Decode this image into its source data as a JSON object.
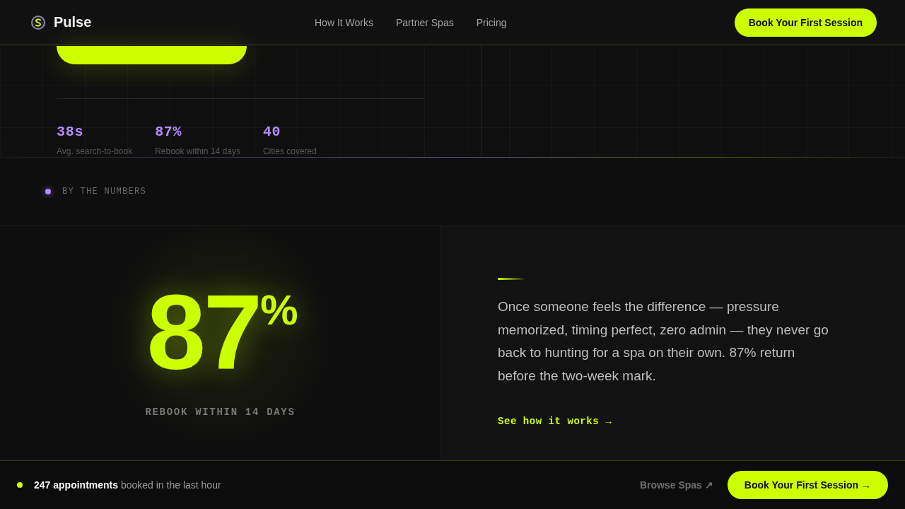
{
  "header": {
    "brand": "Pulse",
    "nav": [
      "How It Works",
      "Partner Spas",
      "Pricing"
    ],
    "cta": "Book Your First Session"
  },
  "hero": {
    "stats": [
      {
        "value": "38s",
        "label": "Avg. search-to-book"
      },
      {
        "value": "87%",
        "label": "Rebook within 14 days"
      },
      {
        "value": "40",
        "label": "Cities covered"
      }
    ]
  },
  "numbers_section": {
    "eyebrow": "BY THE NUMBERS",
    "big_stat": {
      "value": "87",
      "unit": "%",
      "label": "REBOOK WITHIN 14 DAYS"
    },
    "body": "Once someone feels the difference — pressure memorized, timing perfect, zero admin — they never go back to hunting for a spa on their own. 87% return before the two-week mark.",
    "link": "See how it works →"
  },
  "bottom_bar": {
    "live_text": "**247 appointments** booked in the last hour",
    "secondary_link": "Browse Spas ↗",
    "cta": "Book Your First Session →"
  }
}
